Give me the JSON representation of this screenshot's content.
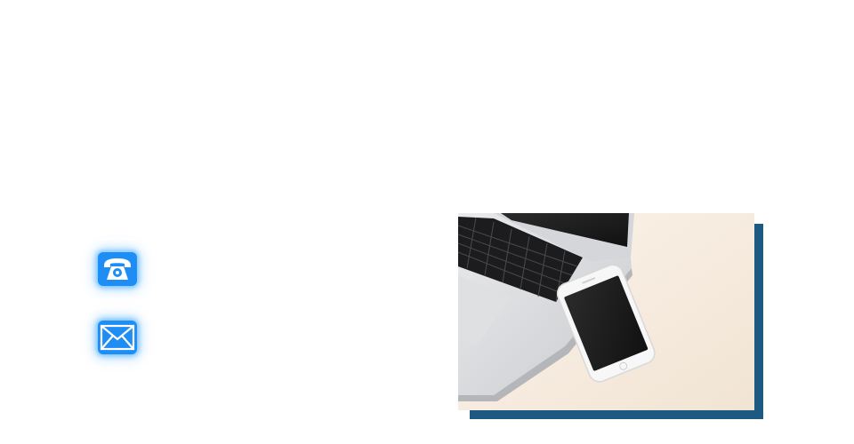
{
  "contact": {
    "phone_icon": "telephone-icon",
    "mail_icon": "envelope-icon",
    "accent_color": "#1e8ef5",
    "glow_color": "#40aaff"
  },
  "photo": {
    "subject": "laptop-and-smartphone-photo",
    "frame_shadow_color": "#1d5a82"
  }
}
